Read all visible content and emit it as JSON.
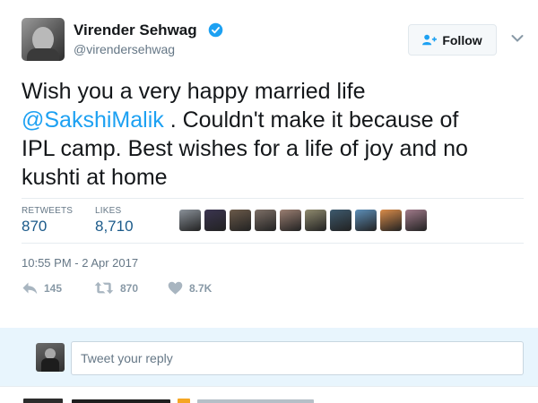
{
  "author": {
    "name": "Virender Sehwag",
    "handle": "@virendersehwag",
    "verified": true
  },
  "follow_button": {
    "label": "Follow",
    "icon": "person-plus-icon"
  },
  "menu": {
    "icon": "chevron-down-icon"
  },
  "tweet": {
    "line1": "Wish you a very happy married life",
    "mention": "@SakshiMalik",
    "line2_rest": " . Couldn't make it because of",
    "line3": "IPL camp. Best wishes for a life of joy and no",
    "line4": "kushti at home"
  },
  "stats": {
    "retweets_label": "RETWEETS",
    "retweets_value": "870",
    "likes_label": "LIKES",
    "likes_value": "8,710"
  },
  "likers": {
    "count": 10,
    "colors": [
      "#8a9199",
      "#3b3550",
      "#6b5a4a",
      "#7d6f66",
      "#9b7f72",
      "#8f8a6e",
      "#3e5a6e",
      "#5d8fb8",
      "#d98c4a",
      "#a07a8a"
    ]
  },
  "timestamp": "10:55 PM - 2 Apr 2017",
  "actions": {
    "reply": {
      "icon": "reply-icon",
      "count": "145"
    },
    "retweet": {
      "icon": "retweet-icon",
      "count": "870"
    },
    "like": {
      "icon": "heart-icon",
      "count": "8.7K"
    }
  },
  "reply_box": {
    "placeholder": "Tweet your reply"
  },
  "colors": {
    "accent": "#1da1f2",
    "muted": "#657786",
    "reply_bg": "#e8f5fd",
    "stat_value": "#1b5a8a"
  }
}
